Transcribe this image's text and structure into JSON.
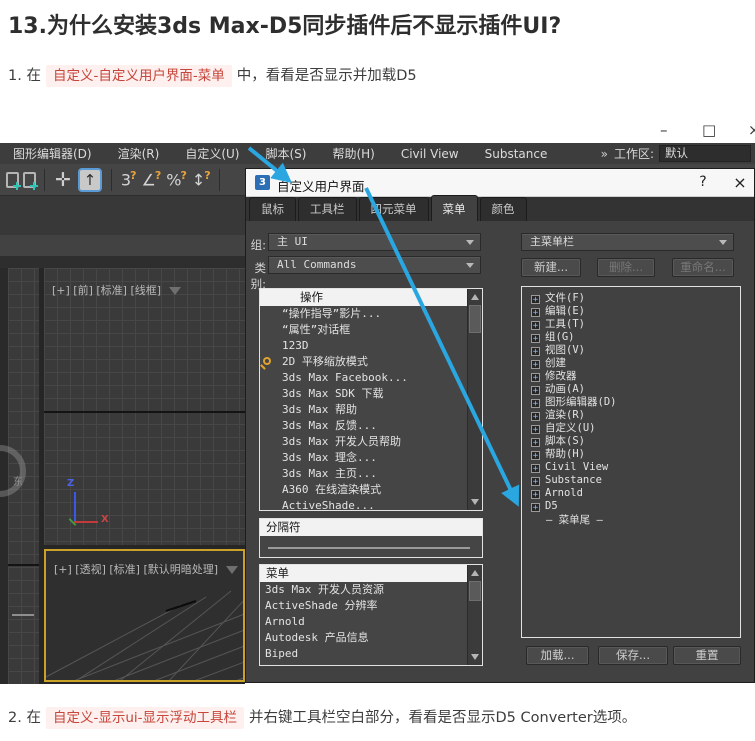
{
  "page": {
    "title": "13.为什么安装3ds Max-D5同步插件后不显示插件UI?",
    "steps": [
      {
        "prefix": "1. 在",
        "highlight": "自定义-自定义用户界面-菜单",
        "suffix": "中，看看是否显示并加载D5"
      },
      {
        "prefix": "2. 在",
        "highlight": "自定义-显示ui-显示浮动工具栏",
        "suffix": "并右键工具栏空白部分，看看是否显示D5 Converter选项。"
      }
    ]
  },
  "window": {
    "controls": {
      "minimize": "–",
      "maximize": "□",
      "close": "×"
    },
    "menubar": {
      "items": [
        "图形编辑器(D)",
        "渲染(R)",
        "自定义(U)",
        "脚本(S)",
        "帮助(H)",
        "Civil View",
        "Substance"
      ],
      "overflow_glyph": "»",
      "workspace_label": "工作区:",
      "workspace_value": "默认"
    },
    "toolbar": {
      "move_glyph": "✛",
      "select_arrow_glyph": "↑",
      "snap3_glyph": "3",
      "angle_glyph": "∠",
      "percent_glyph": "%",
      "spinner_glyph": "↕",
      "hook_glyph": "?"
    },
    "viewports": {
      "front_label": "[+] [前] [标准] [线框]",
      "persp_label": "[+] [透视] [标准] [默认明暗处理]",
      "viewcube_east": "东",
      "axis_z": "Z",
      "axis_x": "X"
    }
  },
  "dialog": {
    "icon_glyph": "3",
    "title": "自定义用户界面",
    "help_glyph": "?",
    "close_glyph": "×",
    "tabs": [
      "鼠标",
      "工具栏",
      "四元菜单",
      "菜单",
      "颜色"
    ],
    "active_tab": "菜单",
    "group_label": "组:",
    "group_value": "主 UI",
    "category_label": "类别:",
    "category_value": "All Commands",
    "menu_bar_value": "主菜单栏",
    "new_button": "新建...",
    "delete_button": "删除...",
    "rename_button": "重命名...",
    "load_button": "加载...",
    "save_button": "保存...",
    "reset_button": "重置",
    "action_list": {
      "header": "操作",
      "items": [
        "“操作指导”影片...",
        "“属性”对话框",
        "123D",
        "2D 平移缩放模式",
        "3ds Max Facebook...",
        "3ds Max SDK 下载",
        "3ds Max 帮助",
        "3ds Max 反馈...",
        "3ds Max 开发人员帮助",
        "3ds Max 理念...",
        "3ds Max 主页...",
        "A360 在线渲染模式",
        "ActiveShade..."
      ]
    },
    "separator_box": {
      "header": "分隔符"
    },
    "menu_list": {
      "header": "菜单",
      "items": [
        "3ds Max 开发人员资源",
        "ActiveShade 分辨率",
        "Arnold",
        "Autodesk 产品信息",
        "Biped"
      ]
    },
    "menu_tree": {
      "expand_glyph": "+",
      "items": [
        "文件(F)",
        "编辑(E)",
        "工具(T)",
        "组(G)",
        "视图(V)",
        "创建",
        "修改器",
        "动画(A)",
        "图形编辑器(D)",
        "渲染(R)",
        "自定义(U)",
        "脚本(S)",
        "帮助(H)",
        "Civil View",
        "Substance",
        "Arnold",
        "D5"
      ],
      "tail": "— 菜单尾 —"
    }
  },
  "colors": {
    "arrow_accent": "#2aa7e0",
    "highlight_text": "#c7453a",
    "highlight_bg": "#fdf0ee",
    "active_viewport_border": "#c9a227"
  }
}
